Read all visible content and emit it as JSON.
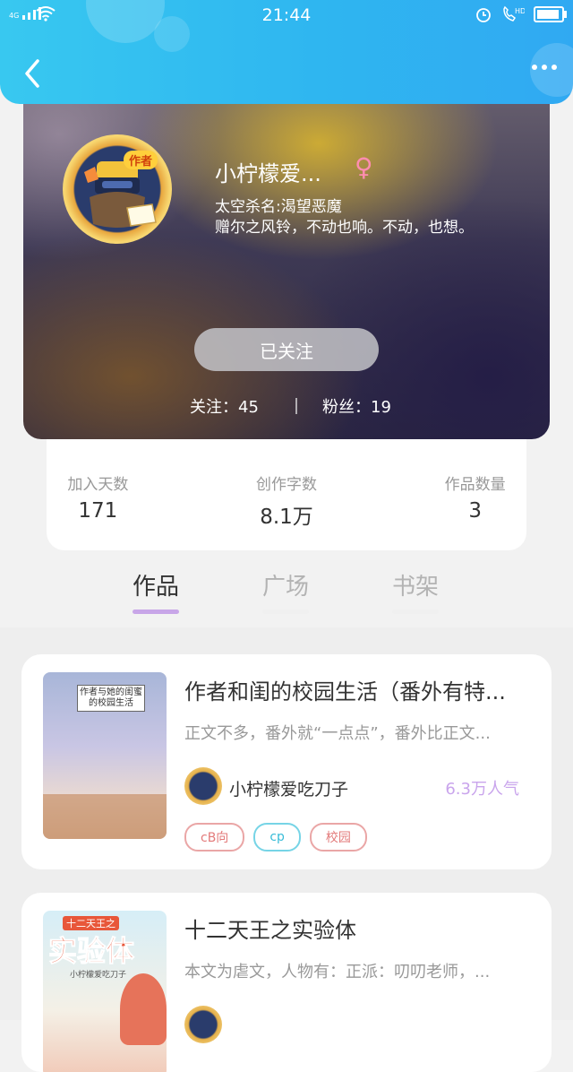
{
  "status_bar": {
    "time": "21:44",
    "network": "4G"
  },
  "profile": {
    "name": "小柠檬爱...",
    "gender_symbol": "♀",
    "badge": "作者",
    "bio_lines": [
      "太空杀名:渴望恶魔",
      "赠尔之风铃，不动也响。不动，也想。"
    ],
    "follow_button": "已关注",
    "following": "关注：45",
    "fans": "粉丝：19"
  },
  "stats": [
    {
      "label": "加入天数",
      "value": "171"
    },
    {
      "label": "创作字数",
      "value": "8.1万"
    },
    {
      "label": "作品数量",
      "value": "3"
    }
  ],
  "tabs": [
    {
      "label": "作品",
      "active": true
    },
    {
      "label": "广场",
      "active": false
    },
    {
      "label": "书架",
      "active": false
    }
  ],
  "works": [
    {
      "title": "作者和闺的校园生活（番外有特...",
      "desc": "正文不多，番外就“一点点”，番外比正文...",
      "author": "小柠檬爱吃刀子",
      "popularity": "6.3万人气",
      "cover_text": "作者与她的闺蜜的校园生活",
      "tags": [
        {
          "label": "cB向",
          "color": "red"
        },
        {
          "label": "cp",
          "color": "cyan"
        },
        {
          "label": "校园",
          "color": "red"
        }
      ]
    },
    {
      "title": "十二天王之实验体",
      "desc": "本文为虐文，人物有：正派：叨叨老师，...",
      "cover_text_small": "十二天王之",
      "cover_text_big": "实验体",
      "cover_text_sub": "小柠檬爱吃刀子"
    }
  ],
  "colors": {
    "accent": "#30b4f0",
    "tab_indicator": "#c8a6e8",
    "popularity": "#c9a4ec"
  }
}
